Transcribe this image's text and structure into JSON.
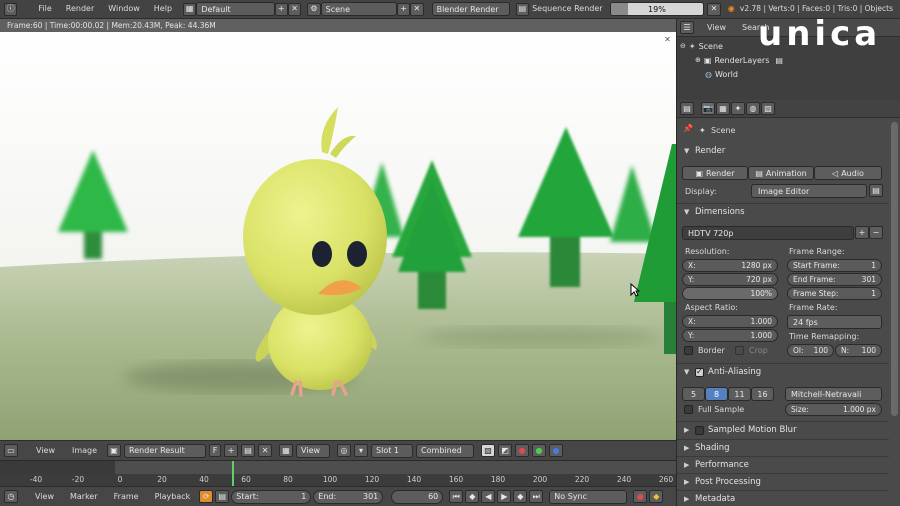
{
  "topbar": {
    "menus": [
      "File",
      "Render",
      "Window",
      "Help"
    ],
    "layout": "Default",
    "scene": "Scene",
    "engine": "Blender Render",
    "sequence_render": "Sequence Render",
    "progress_label": "19%",
    "progress": 0.19,
    "stats": "v2.78 | Verts:0 | Faces:0 | Tris:0 | Objects"
  },
  "render_info": "Frame:60 | Time:00:00.02 | Mem:20.43M, Peak: 44.36M",
  "image_header": {
    "view": "View",
    "image": "Image",
    "image_name": "Render Result",
    "fake_user": "F",
    "view2": "View",
    "slot": "Slot 1",
    "pass": "Combined"
  },
  "timeline": {
    "ticks": [
      "-40",
      "-20",
      "0",
      "20",
      "40",
      "60",
      "80",
      "100",
      "120",
      "140",
      "160",
      "180",
      "200",
      "220",
      "240",
      "260"
    ],
    "current_frame": 60
  },
  "timeline_header": {
    "view": "View",
    "marker": "Marker",
    "frame": "Frame",
    "playback": "Playback",
    "start_label": "Start:",
    "start": "1",
    "end_label": "End:",
    "end": "301",
    "current": "60",
    "sync": "No Sync"
  },
  "outliner": {
    "view": "View",
    "search": "Search",
    "rows": [
      "Scene",
      "RenderLayers",
      "World"
    ]
  },
  "properties": {
    "context": "Scene",
    "render_panel": {
      "title": "Render",
      "render_btn": "Render",
      "animation_btn": "Animation",
      "audio_btn": "Audio",
      "display_label": "Display:",
      "display_value": "Image Editor"
    },
    "dimensions": {
      "title": "Dimensions",
      "preset": "HDTV 720p",
      "resolution_label": "Resolution:",
      "x_label": "X:",
      "x_value": "1280 px",
      "y_label": "Y:",
      "y_value": "720 px",
      "percent": "100%",
      "frame_range_label": "Frame Range:",
      "start_frame_label": "Start Frame:",
      "start_frame": "1",
      "end_frame_label": "End Frame:",
      "end_frame": "301",
      "frame_step_label": "Frame Step:",
      "frame_step": "1",
      "aspect_label": "Aspect Ratio:",
      "ax_label": "X:",
      "ax_value": "1.000",
      "ay_label": "Y:",
      "ay_value": "1.000",
      "frame_rate_label": "Frame Rate:",
      "frame_rate": "24 fps",
      "time_remap_label": "Time Remapping:",
      "old_label": "Ol:",
      "old_value": "100",
      "new_label": "N:",
      "new_value": "100",
      "border": "Border",
      "crop": "Crop"
    },
    "anti_aliasing": {
      "title": "Anti-Aliasing",
      "samples": [
        "5",
        "8",
        "11",
        "16"
      ],
      "selected": "8",
      "filter": "Mitchell-Netravali",
      "full_sample": "Full Sample",
      "size_label": "Size:",
      "size_value": "1.000 px"
    },
    "collapsed": [
      "Sampled Motion Blur",
      "Shading",
      "Performance",
      "Post Processing",
      "Metadata"
    ]
  },
  "logo": "unica",
  "colors": {
    "accent_blue": "#5680c2",
    "timeline_cursor": "#5fd06a",
    "chick_yellow": "#dde66a",
    "beak_orange": "#f0a04a",
    "tree_green": "#23a83a",
    "ground_green": "#a7b98c"
  }
}
